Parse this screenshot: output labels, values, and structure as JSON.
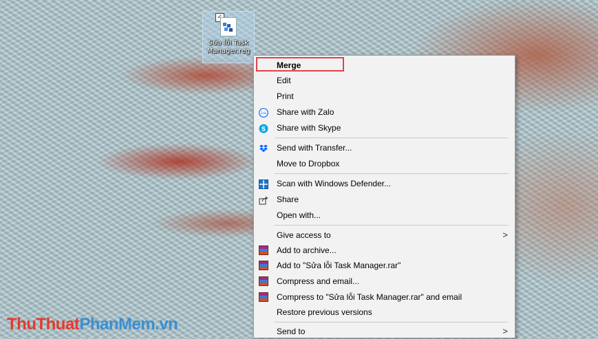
{
  "desktop": {
    "file_label_line1": "Sửa lỗi Task",
    "file_label_line2": "Manager.reg"
  },
  "menu": {
    "items": [
      {
        "label": "Merge",
        "icon": "none",
        "bold": true
      },
      {
        "label": "Edit",
        "icon": "none"
      },
      {
        "label": "Print",
        "icon": "none"
      },
      {
        "label": "Share with Zalo",
        "icon": "zalo-icon"
      },
      {
        "label": "Share with Skype",
        "icon": "skype-icon"
      },
      {
        "label": "Send with Transfer...",
        "icon": "dropbox-icon"
      },
      {
        "label": "Move to Dropbox",
        "icon": "none"
      },
      {
        "label": "Scan with Windows Defender...",
        "icon": "defender-icon"
      },
      {
        "label": "Share",
        "icon": "share-icon"
      },
      {
        "label": "Open with...",
        "icon": "none"
      },
      {
        "label": "Give access to",
        "icon": "none",
        "submenu": true
      },
      {
        "label": "Add to archive...",
        "icon": "winrar-icon"
      },
      {
        "label": "Add to \"Sửa lỗi Task Manager.rar\"",
        "icon": "winrar-icon"
      },
      {
        "label": "Compress and email...",
        "icon": "winrar-icon"
      },
      {
        "label": "Compress to \"Sửa lỗi Task Manager.rar\" and email",
        "icon": "winrar-icon"
      },
      {
        "label": "Restore previous versions",
        "icon": "none"
      },
      {
        "label": "Send to",
        "icon": "none",
        "submenu": true
      }
    ],
    "submenu_arrow": ">"
  },
  "watermark": {
    "part1": "ThuThuat",
    "part2": "PhanMem.vn"
  },
  "colors": {
    "highlight_box": "#e0404a",
    "menu_bg": "#f2f2f2"
  }
}
